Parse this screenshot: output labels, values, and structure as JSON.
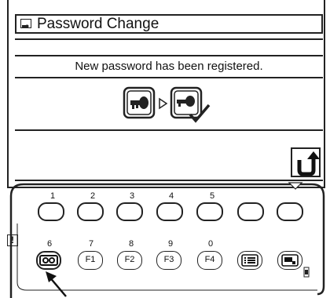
{
  "screen": {
    "title": "Password Change",
    "message": "New password has been registered.",
    "title_icon": "key-card-icon",
    "status_icons": [
      "key-locked-icon",
      "arrow-right-icon",
      "key-check-icon"
    ],
    "back_icon": "return-arrow-icon"
  },
  "keypad": {
    "top_numbers": [
      "1",
      "2",
      "3",
      "4",
      "5"
    ],
    "bottom_numbers": [
      "6",
      "7",
      "8",
      "9",
      "0"
    ],
    "fkeys": [
      "F1",
      "F2",
      "F3",
      "F4"
    ],
    "warning_label": "!",
    "special_icons": [
      "cassette-icon",
      "menu-list-icon",
      "monitor-icon"
    ]
  }
}
